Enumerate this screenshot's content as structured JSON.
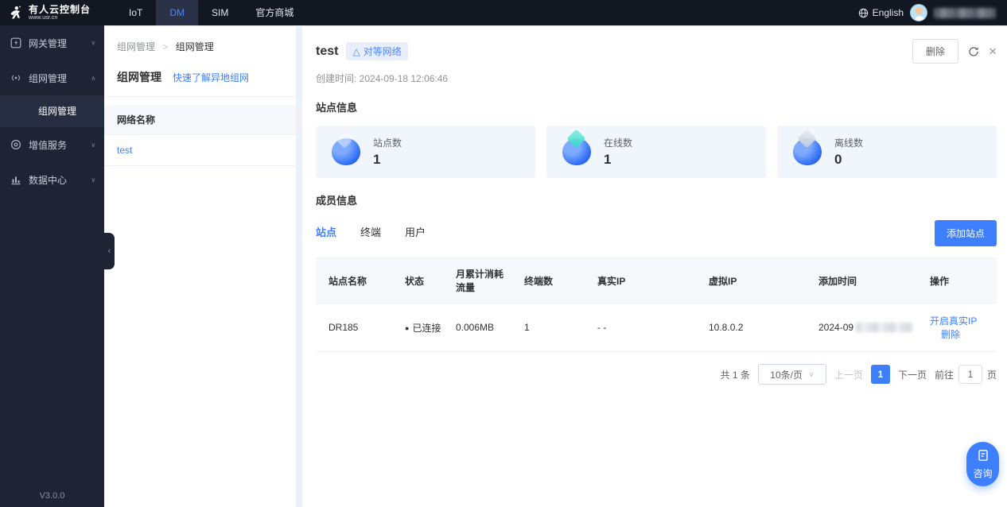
{
  "topbar": {
    "logo_title": "有人云控制台",
    "logo_subtitle": "www.usr.cn",
    "nav": [
      {
        "label": "IoT",
        "active": false
      },
      {
        "label": "DM",
        "active": true
      },
      {
        "label": "SIM",
        "active": false
      },
      {
        "label": "官方商城",
        "active": false
      }
    ],
    "language": "English",
    "user_redacted": true
  },
  "sidebar": {
    "items": [
      {
        "label": "网关管理",
        "icon": "gateway-icon",
        "expanded": false
      },
      {
        "label": "组网管理",
        "icon": "network-icon",
        "expanded": true,
        "children": [
          {
            "label": "组网管理",
            "active": true
          }
        ]
      },
      {
        "label": "增值服务",
        "icon": "value-service-icon",
        "expanded": false
      },
      {
        "label": "数据中心",
        "icon": "data-center-icon",
        "expanded": false
      }
    ],
    "version": "V3.0.0"
  },
  "list_panel": {
    "breadcrumb": [
      "组网管理",
      "组网管理"
    ],
    "title": "组网管理",
    "help_link": "快速了解异地组网",
    "column_header": "网络名称",
    "rows": [
      {
        "name": "test"
      }
    ]
  },
  "main": {
    "title": "test",
    "badge": "对等网络",
    "created_label": "创建时间: 2024-09-18 12:06:46",
    "delete_button": "删除",
    "section_site_info": "站点信息",
    "stats": [
      {
        "label": "站点数",
        "value": "1"
      },
      {
        "label": "在线数",
        "value": "1"
      },
      {
        "label": "离线数",
        "value": "0"
      }
    ],
    "section_members": "成员信息",
    "tabs": [
      {
        "label": "站点",
        "active": true
      },
      {
        "label": "终端",
        "active": false
      },
      {
        "label": "用户",
        "active": false
      }
    ],
    "add_site_button": "添加站点",
    "table": {
      "columns": [
        "站点名称",
        "状态",
        "月累计消耗流量",
        "终端数",
        "真实IP",
        "虚拟IP",
        "添加时间",
        "操作"
      ],
      "rows": [
        {
          "name": "DR185",
          "status": "已连接",
          "traffic": "0.006MB",
          "terminals": "1",
          "real_ip": "- -",
          "virtual_ip": "10.8.0.2",
          "added_time": "2024-09",
          "added_time_redacted": true,
          "actions": [
            "开启真实IP",
            "删除"
          ]
        }
      ]
    },
    "pagination": {
      "total": "共 1 条",
      "page_size": "10条/页",
      "prev": "上一页",
      "current": "1",
      "next": "下一页",
      "goto_prefix": "前往",
      "goto_value": "1",
      "goto_suffix": "页"
    }
  },
  "floating": {
    "consult": "咨询"
  },
  "icons": {
    "warning_triangle": "△",
    "chevron_down": "∨",
    "chevron_up": "∧",
    "chevron_left": "‹",
    "close": "×",
    "status_dot": "●",
    "breadcrumb_separator": ">",
    "select_arrow": "∨"
  },
  "colors": {
    "primary": "#3d7fff",
    "success_green": "#2fbf7f",
    "topbar_bg": "#131722",
    "sidebar_bg": "#1e2433",
    "card_bg": "#f1f5fc",
    "badge_bg": "#e9eefb"
  }
}
